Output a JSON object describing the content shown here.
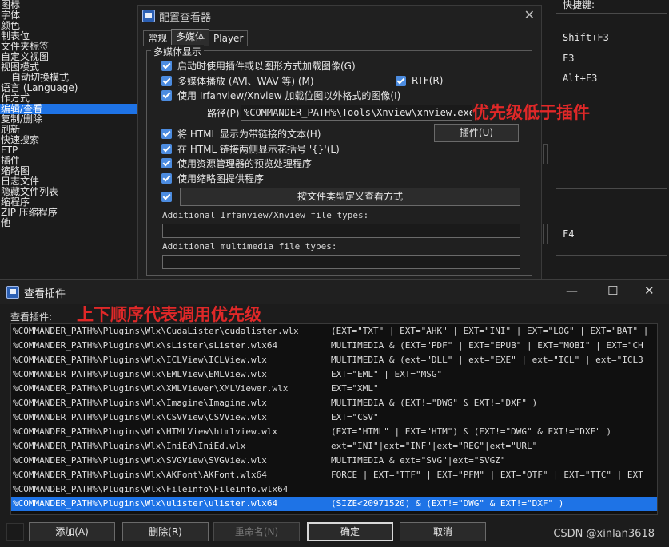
{
  "left_list": {
    "items": [
      {
        "label": "图标",
        "indent": false,
        "selected": false
      },
      {
        "label": "字体",
        "indent": false,
        "selected": false
      },
      {
        "label": "颜色",
        "indent": false,
        "selected": false
      },
      {
        "label": "制表位",
        "indent": false,
        "selected": false
      },
      {
        "label": "文件夹标签",
        "indent": false,
        "selected": false
      },
      {
        "label": "自定义视图",
        "indent": false,
        "selected": false
      },
      {
        "label": "视图模式",
        "indent": false,
        "selected": false
      },
      {
        "label": "自动切换模式",
        "indent": true,
        "selected": false
      },
      {
        "label": "语言 (Language)",
        "indent": false,
        "selected": false
      },
      {
        "label": "作方式",
        "indent": false,
        "selected": false
      },
      {
        "label": "编辑/查看",
        "indent": false,
        "selected": true
      },
      {
        "label": "复制/删除",
        "indent": false,
        "selected": false
      },
      {
        "label": "刷新",
        "indent": false,
        "selected": false
      },
      {
        "label": "快速搜索",
        "indent": false,
        "selected": false
      },
      {
        "label": "FTP",
        "indent": false,
        "selected": false
      },
      {
        "label": "插件",
        "indent": false,
        "selected": false
      },
      {
        "label": "缩略图",
        "indent": false,
        "selected": false
      },
      {
        "label": "日志文件",
        "indent": false,
        "selected": false
      },
      {
        "label": "隐藏文件列表",
        "indent": false,
        "selected": false
      },
      {
        "label": "缩程序",
        "indent": false,
        "selected": false
      },
      {
        "label": "ZIP 压缩程序",
        "indent": false,
        "selected": false
      },
      {
        "label": "他",
        "indent": false,
        "selected": false
      }
    ]
  },
  "background_right": {
    "header": "快捷键:",
    "shortcuts": [
      "Shift+F3",
      "F3",
      "Alt+F3"
    ],
    "lower_shortcut": "F4"
  },
  "config_dialog": {
    "title": "配置查看器",
    "tabs": [
      "常规",
      "多媒体",
      "Player"
    ],
    "active_tab": "多媒体",
    "group_title": "多媒体显示",
    "options": {
      "load_images": "启动时使用插件或以图形方式加载图像(G)",
      "multimedia": "多媒体播放 (AVI、WAV 等) (M)",
      "rtf": "RTF(R)",
      "irfanview": "使用 Irfanview/Xnview 加载位图以外格式的图像(I)",
      "html": "将 HTML 显示为带链接的文本(H)",
      "braces": "在 HTML 链接两侧显示花括号 '{}'(L)",
      "explorer_preview": "使用资源管理器的预览处理程序",
      "thumbnail": "使用缩略图提供程序"
    },
    "path_label": "路径(P):",
    "path_value": "%COMMANDER_PATH%\\Tools\\Xnview\\xnview.exe",
    "plugin_button": "插件(U)",
    "define_button": "按文件类型定义查看方式",
    "irfan_types_label": "Additional Irfanview/Xnview file types:",
    "irfan_types_value": "",
    "multimedia_types_label": "Additional multimedia file types:",
    "multimedia_types_value": "",
    "note": "优先级低于插件"
  },
  "plugins_dialog": {
    "title": "查看插件",
    "list_label": "查看插件:",
    "note": "上下顺序代表调用优先级",
    "plugins": [
      {
        "path": "%COMMANDER_PATH%\\Plugins\\Wlx\\CudaLister\\cudalister.wlx",
        "detect": "(EXT=\"TXT\" | EXT=\"AHK\" | EXT=\"INI\" | EXT=\"LOG\" | EXT=\"BAT\" |",
        "selected": false
      },
      {
        "path": "%COMMANDER_PATH%\\Plugins\\Wlx\\sLister\\sLister.wlx64",
        "detect": "MULTIMEDIA & (EXT=\"PDF\" | EXT=\"EPUB\" | EXT=\"MOBI\" | EXT=\"CH",
        "selected": false
      },
      {
        "path": "%COMMANDER_PATH%\\Plugins\\Wlx\\ICLView\\ICLView.wlx",
        "detect": "MULTIMEDIA & (ext=\"DLL\" | ext=\"EXE\" | ext=\"ICL\" | ext=\"ICL3",
        "selected": false
      },
      {
        "path": "%COMMANDER_PATH%\\Plugins\\Wlx\\EMLView\\EMLView.wlx",
        "detect": "EXT=\"EML\" | EXT=\"MSG\"",
        "selected": false
      },
      {
        "path": "%COMMANDER_PATH%\\Plugins\\Wlx\\XMLViewer\\XMLViewer.wlx",
        "detect": "EXT=\"XML\"",
        "selected": false
      },
      {
        "path": "%COMMANDER_PATH%\\Plugins\\Wlx\\Imagine\\Imagine.wlx",
        "detect": "MULTIMEDIA & (EXT!=\"DWG\" & EXT!=\"DXF\" )",
        "selected": false
      },
      {
        "path": "%COMMANDER_PATH%\\Plugins\\Wlx\\CSVView\\CSVView.wlx",
        "detect": "EXT=\"CSV\"",
        "selected": false
      },
      {
        "path": "%COMMANDER_PATH%\\Plugins\\Wlx\\HTMLView\\htmlview.wlx",
        "detect": "(EXT=\"HTML\" | EXT=\"HTM\") & (EXT!=\"DWG\" & EXT!=\"DXF\" )",
        "selected": false
      },
      {
        "path": "%COMMANDER_PATH%\\Plugins\\Wlx\\IniEd\\IniEd.wlx",
        "detect": "ext=\"INI\"|ext=\"INF\"|ext=\"REG\"|ext=\"URL\"",
        "selected": false
      },
      {
        "path": "%COMMANDER_PATH%\\Plugins\\Wlx\\SVGView\\SVGView.wlx",
        "detect": "MULTIMEDIA & ext=\"SVG\"|ext=\"SVGZ\"",
        "selected": false
      },
      {
        "path": "%COMMANDER_PATH%\\Plugins\\Wlx\\AKFont\\AKFont.wlx64",
        "detect": "FORCE | EXT=\"TTF\" | EXT=\"PFM\" | EXT=\"OTF\" | EXT=\"TTC\" | EXT",
        "selected": false
      },
      {
        "path": "%COMMANDER_PATH%\\Plugins\\Wlx\\Fileinfo\\Fileinfo.wlx64",
        "detect": "",
        "selected": false
      },
      {
        "path": "%COMMANDER_PATH%\\Plugins\\Wlx\\ulister\\ulister.wlx64",
        "detect": "(SIZE<20971520) & (EXT!=\"DWG\" & EXT!=\"DXF\" )",
        "selected": true
      }
    ],
    "buttons": {
      "add": "添加(A)",
      "delete": "删除(R)",
      "rename": "重命名(N)",
      "ok": "确定",
      "cancel": "取消"
    },
    "watermark": "CSDN @xinlan3618"
  }
}
